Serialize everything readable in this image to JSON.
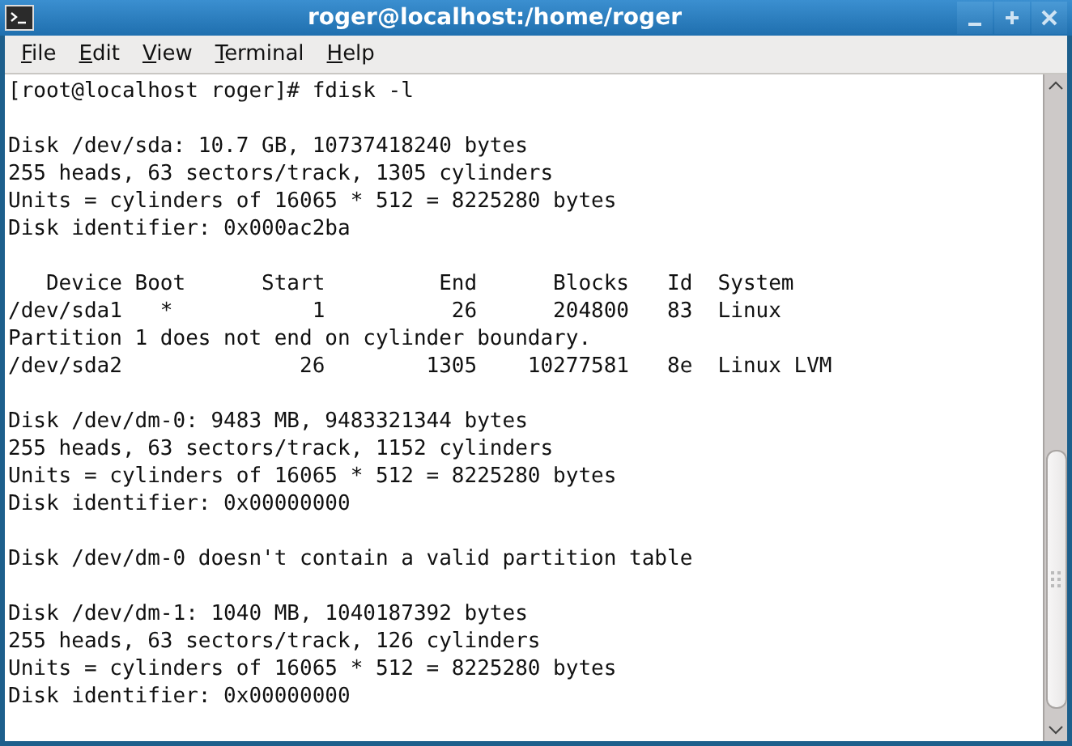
{
  "window": {
    "title": "roger@localhost:/home/roger"
  },
  "menu": [
    {
      "label": "File"
    },
    {
      "label": "Edit"
    },
    {
      "label": "View"
    },
    {
      "label": "Terminal"
    },
    {
      "label": "Help"
    }
  ],
  "terminal": {
    "blocks": [
      [
        "[root@localhost roger]# fdisk -l"
      ],
      [
        "Disk /dev/sda: 10.7 GB, 10737418240 bytes",
        "255 heads, 63 sectors/track, 1305 cylinders",
        "Units = cylinders of 16065 * 512 = 8225280 bytes",
        "Disk identifier: 0x000ac2ba"
      ],
      [
        "   Device Boot      Start         End      Blocks   Id  System",
        "/dev/sda1   *           1          26      204800   83  Linux",
        "Partition 1 does not end on cylinder boundary.",
        "/dev/sda2              26        1305    10277581   8e  Linux LVM"
      ],
      [
        "Disk /dev/dm-0: 9483 MB, 9483321344 bytes",
        "255 heads, 63 sectors/track, 1152 cylinders",
        "Units = cylinders of 16065 * 512 = 8225280 bytes",
        "Disk identifier: 0x00000000"
      ],
      [
        "Disk /dev/dm-0 doesn't contain a valid partition table"
      ],
      [
        "Disk /dev/dm-1: 1040 MB, 1040187392 bytes",
        "255 heads, 63 sectors/track, 126 cylinders",
        "Units = cylinders of 16065 * 512 = 8225280 bytes",
        "Disk identifier: 0x00000000"
      ]
    ]
  }
}
